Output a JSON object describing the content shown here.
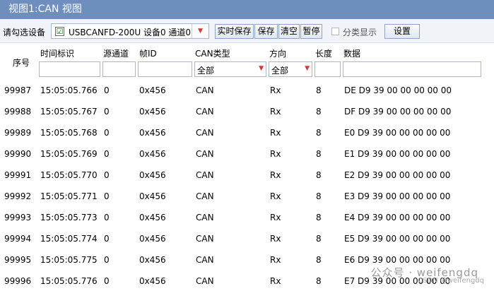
{
  "window": {
    "title": "视图1:CAN 视图"
  },
  "toolbar": {
    "device_label": "请勾选设备",
    "device_value": "USBCANFD-200U 设备0 通道0",
    "device_checked": "☑",
    "realtime_save": "实时保存",
    "save": "保存",
    "clear": "清空",
    "pause": "暂停",
    "category_display": "分类显示",
    "settings": "设置"
  },
  "columns": {
    "seq": "序号",
    "time": "时间标识",
    "src": "源通道",
    "frame_id": "帧ID",
    "can_type": "CAN类型",
    "direction": "方向",
    "length": "长度",
    "data": "数据"
  },
  "filters": {
    "can_type": "全部",
    "direction": "全部"
  },
  "rows": [
    {
      "seq": "99987",
      "time": "15:05:05.766",
      "src": "0",
      "id": "0x456",
      "type": "CAN",
      "dir": "Rx",
      "len": "8",
      "data": "DE D9 39 00 00 00 00 00"
    },
    {
      "seq": "99988",
      "time": "15:05:05.767",
      "src": "0",
      "id": "0x456",
      "type": "CAN",
      "dir": "Rx",
      "len": "8",
      "data": "DF D9 39 00 00 00 00 00"
    },
    {
      "seq": "99989",
      "time": "15:05:05.768",
      "src": "0",
      "id": "0x456",
      "type": "CAN",
      "dir": "Rx",
      "len": "8",
      "data": "E0 D9 39 00 00 00 00 00"
    },
    {
      "seq": "99990",
      "time": "15:05:05.769",
      "src": "0",
      "id": "0x456",
      "type": "CAN",
      "dir": "Rx",
      "len": "8",
      "data": "E1 D9 39 00 00 00 00 00"
    },
    {
      "seq": "99991",
      "time": "15:05:05.770",
      "src": "0",
      "id": "0x456",
      "type": "CAN",
      "dir": "Rx",
      "len": "8",
      "data": "E2 D9 39 00 00 00 00 00"
    },
    {
      "seq": "99992",
      "time": "15:05:05.771",
      "src": "0",
      "id": "0x456",
      "type": "CAN",
      "dir": "Rx",
      "len": "8",
      "data": "E3 D9 39 00 00 00 00 00"
    },
    {
      "seq": "99993",
      "time": "15:05:05.773",
      "src": "0",
      "id": "0x456",
      "type": "CAN",
      "dir": "Rx",
      "len": "8",
      "data": "E4 D9 39 00 00 00 00 00"
    },
    {
      "seq": "99994",
      "time": "15:05:05.774",
      "src": "0",
      "id": "0x456",
      "type": "CAN",
      "dir": "Rx",
      "len": "8",
      "data": "E5 D9 39 00 00 00 00 00"
    },
    {
      "seq": "99995",
      "time": "15:05:05.775",
      "src": "0",
      "id": "0x456",
      "type": "CAN",
      "dir": "Rx",
      "len": "8",
      "data": "E6 D9 39 00 00 00 00 00"
    },
    {
      "seq": "99996",
      "time": "15:05:05.776",
      "src": "0",
      "id": "0x456",
      "type": "CAN",
      "dir": "Rx",
      "len": "8",
      "data": "E7 D9 39 00 00 00 00 00"
    }
  ],
  "watermark": {
    "main": "公众号 · weifengdq",
    "sub": "CSDN @weifengdq"
  }
}
